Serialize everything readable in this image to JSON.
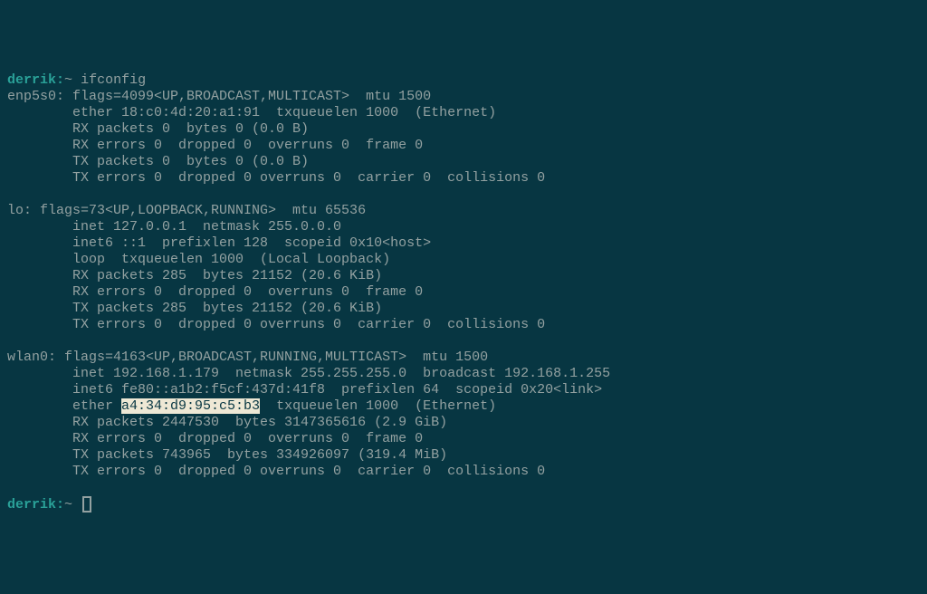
{
  "prompt": {
    "user": "derrik",
    "sep": ":",
    "path": "~",
    "cursor_prompt": " "
  },
  "cmd1": "ifconfig",
  "iface1": {
    "line1": "enp5s0: flags=4099<UP,BROADCAST,MULTICAST>  mtu 1500",
    "line2": "        ether 18:c0:4d:20:a1:91  txqueuelen 1000  (Ethernet)",
    "line3": "        RX packets 0  bytes 0 (0.0 B)",
    "line4": "        RX errors 0  dropped 0  overruns 0  frame 0",
    "line5": "        TX packets 0  bytes 0 (0.0 B)",
    "line6": "        TX errors 0  dropped 0 overruns 0  carrier 0  collisions 0"
  },
  "iface2": {
    "line1": "lo: flags=73<UP,LOOPBACK,RUNNING>  mtu 65536",
    "line2": "        inet 127.0.0.1  netmask 255.0.0.0",
    "line3": "        inet6 ::1  prefixlen 128  scopeid 0x10<host>",
    "line4": "        loop  txqueuelen 1000  (Local Loopback)",
    "line5": "        RX packets 285  bytes 21152 (20.6 KiB)",
    "line6": "        RX errors 0  dropped 0  overruns 0  frame 0",
    "line7": "        TX packets 285  bytes 21152 (20.6 KiB)",
    "line8": "        TX errors 0  dropped 0 overruns 0  carrier 0  collisions 0"
  },
  "iface3": {
    "line1": "wlan0: flags=4163<UP,BROADCAST,RUNNING,MULTICAST>  mtu 1500",
    "line2": "        inet 192.168.1.179  netmask 255.255.255.0  broadcast 192.168.1.255",
    "line3": "        inet6 fe80::a1b2:f5cf:437d:41f8  prefixlen 64  scopeid 0x20<link>",
    "line4_pre": "        ether ",
    "line4_hl": "a4:34:d9:95:c5:b3",
    "line4_post": "  txqueuelen 1000  (Ethernet)",
    "line5": "        RX packets 2447530  bytes 3147365616 (2.9 GiB)",
    "line6": "        RX errors 0  dropped 0  overruns 0  frame 0",
    "line7": "        TX packets 743965  bytes 334926097 (319.4 MiB)",
    "line8": "        TX errors 0  dropped 0 overruns 0  carrier 0  collisions 0"
  }
}
